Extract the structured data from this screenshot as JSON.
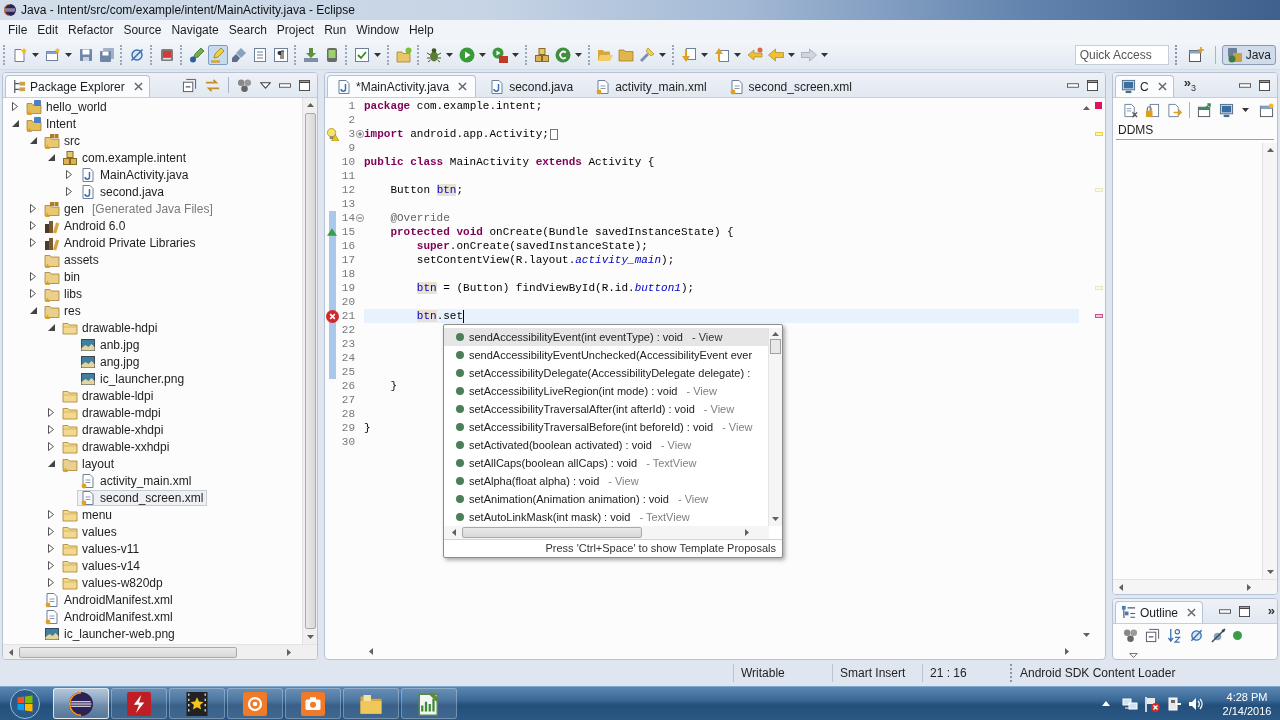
{
  "window": {
    "title": "Java - Intent/src/com/example/intent/MainActivity.java - Eclipse"
  },
  "menu": [
    "File",
    "Edit",
    "Refactor",
    "Source",
    "Navigate",
    "Search",
    "Project",
    "Run",
    "Window",
    "Help"
  ],
  "toolbar": {
    "groups": [
      [
        {
          "kind": "new",
          "dropdown": true,
          "pressed": false
        },
        {
          "kind": "new-window",
          "dropdown": true,
          "pressed": false
        },
        {
          "kind": "save",
          "pressed": false
        },
        {
          "kind": "save-all",
          "pressed": false
        }
      ],
      [
        {
          "kind": "skip-breakpoints",
          "pressed": false
        }
      ],
      [
        {
          "kind": "ddms",
          "pressed": false
        }
      ],
      [
        {
          "kind": "marker-pen",
          "pressed": false
        },
        {
          "kind": "highlighter",
          "pressed": true
        },
        {
          "kind": "brush",
          "pressed": false
        },
        {
          "kind": "block-select",
          "pressed": false
        },
        {
          "kind": "pilcrow",
          "pressed": false
        }
      ],
      [
        {
          "kind": "sdk-download",
          "pressed": false
        },
        {
          "kind": "phone",
          "pressed": false
        }
      ],
      [
        {
          "kind": "checkbox",
          "dropdown": true,
          "pressed": false
        }
      ],
      [
        {
          "kind": "new-project",
          "pressed": false
        }
      ],
      [
        {
          "kind": "bug",
          "dropdown": true,
          "pressed": false
        },
        {
          "kind": "play",
          "dropdown": true,
          "pressed": false
        },
        {
          "kind": "tool-run",
          "dropdown": true,
          "pressed": false
        }
      ],
      [
        {
          "kind": "package-new",
          "pressed": false
        },
        {
          "kind": "class-new",
          "dropdown": true,
          "pressed": false
        }
      ],
      [
        {
          "kind": "folder-open",
          "pressed": false
        },
        {
          "kind": "folder-task",
          "pressed": false
        },
        {
          "kind": "flashlight",
          "dropdown": true,
          "pressed": false
        }
      ],
      [
        {
          "kind": "annotation-next",
          "dropdown": true,
          "pressed": false
        },
        {
          "kind": "annotation-prev",
          "dropdown": true,
          "pressed": false
        },
        {
          "kind": "last-edit",
          "pressed": false
        },
        {
          "kind": "back",
          "dropdown": true,
          "pressed": false
        },
        {
          "kind": "forward",
          "dropdown": true,
          "pressed": false
        }
      ]
    ],
    "quick_access": {
      "placeholder": "Quick Access"
    },
    "perspectives": [
      {
        "kind": "open-perspective",
        "selected": false
      },
      {
        "kind": "java",
        "label": "Java",
        "selected": true
      }
    ]
  },
  "package_explorer": {
    "tab": {
      "label": "Package Explorer",
      "selected": true
    },
    "tree": [
      {
        "label": "hello_world",
        "kind": "project",
        "expanded": false,
        "selected": false
      },
      {
        "label": "Intent",
        "kind": "project",
        "expanded": true,
        "selected": false,
        "children": [
          {
            "label": "src",
            "kind": "source-folder",
            "expanded": true,
            "selected": false,
            "children": [
              {
                "label": "com.example.intent",
                "kind": "package",
                "expanded": true,
                "selected": false,
                "children": [
                  {
                    "label": "MainActivity.java",
                    "kind": "java-file",
                    "expanded": false,
                    "selected": false
                  },
                  {
                    "label": "second.java",
                    "kind": "java-file",
                    "expanded": false,
                    "selected": false
                  }
                ]
              }
            ]
          },
          {
            "label": "gen",
            "note": "[Generated Java Files]",
            "kind": "source-folder",
            "expanded": false,
            "selected": false
          },
          {
            "label": "Android 6.0",
            "kind": "library",
            "expanded": false,
            "selected": false
          },
          {
            "label": "Android Private Libraries",
            "kind": "library",
            "expanded": false,
            "selected": false
          },
          {
            "label": "assets",
            "kind": "resource-folder",
            "selected": false
          },
          {
            "label": "bin",
            "kind": "resource-folder",
            "expanded": false,
            "selected": false
          },
          {
            "label": "libs",
            "kind": "resource-folder",
            "expanded": false,
            "selected": false
          },
          {
            "label": "res",
            "kind": "resource-folder",
            "expanded": true,
            "selected": false,
            "children": [
              {
                "label": "drawable-hdpi",
                "kind": "folder",
                "expanded": true,
                "selected": false,
                "children": [
                  {
                    "label": "anb.jpg",
                    "kind": "image-file",
                    "selected": false
                  },
                  {
                    "label": "ang.jpg",
                    "kind": "image-file",
                    "selected": false
                  },
                  {
                    "label": "ic_launcher.png",
                    "kind": "image-file",
                    "selected": false
                  }
                ]
              },
              {
                "label": "drawable-ldpi",
                "kind": "folder",
                "selected": false
              },
              {
                "label": "drawable-mdpi",
                "kind": "folder",
                "expanded": false,
                "selected": false
              },
              {
                "label": "drawable-xhdpi",
                "kind": "folder",
                "expanded": false,
                "selected": false
              },
              {
                "label": "drawable-xxhdpi",
                "kind": "folder",
                "expanded": false,
                "selected": false
              },
              {
                "label": "layout",
                "kind": "resource-folder",
                "expanded": true,
                "selected": false,
                "children": [
                  {
                    "label": "activity_main.xml",
                    "kind": "xml-file",
                    "selected": false
                  },
                  {
                    "label": "second_screen.xml",
                    "kind": "xml-file",
                    "selected": true
                  }
                ]
              },
              {
                "label": "menu",
                "kind": "folder",
                "expanded": false,
                "selected": false
              },
              {
                "label": "values",
                "kind": "folder",
                "expanded": false,
                "selected": false
              },
              {
                "label": "values-v11",
                "kind": "folder",
                "expanded": false,
                "selected": false
              },
              {
                "label": "values-v14",
                "kind": "folder",
                "expanded": false,
                "selected": false
              },
              {
                "label": "values-w820dp",
                "kind": "folder",
                "expanded": false,
                "selected": false
              }
            ]
          },
          {
            "label": "AndroidManifest.xml",
            "kind": "xml-file",
            "selected": false
          },
          {
            "label": "AndroidManifest.xml",
            "kind": "xml-file",
            "selected": false
          },
          {
            "label": "ic_launcher-web.png",
            "kind": "image-file",
            "selected": false
          }
        ]
      }
    ]
  },
  "editor": {
    "tabs": [
      {
        "label": "*MainActivity.java",
        "kind": "java-file",
        "selected": true
      },
      {
        "label": "second.java",
        "kind": "java-file",
        "selected": false
      },
      {
        "label": "activity_main.xml",
        "kind": "xml-file",
        "selected": false
      },
      {
        "label": "second_screen.xml",
        "kind": "xml-file",
        "selected": false
      }
    ],
    "lines": [
      {
        "number": "1",
        "tokens": [
          {
            "text": "package",
            "kind": "keyword"
          },
          {
            "text": " com.example.intent;",
            "kind": "plain"
          }
        ]
      },
      {
        "number": "2"
      },
      {
        "number": "3",
        "gutter_mark": {
          "kind": "warning"
        },
        "fold": {
          "collapsed": true
        },
        "tokens": [
          {
            "text": "import",
            "kind": "keyword"
          },
          {
            "text": " android.app.Activity;",
            "kind": "plain"
          }
        ]
      },
      {
        "number": "9"
      },
      {
        "number": "10",
        "tokens": [
          {
            "text": "public",
            "kind": "keyword"
          },
          {
            "text": " class",
            "kind": "keyword"
          },
          {
            "text": " MainActivity ",
            "kind": "plain"
          },
          {
            "text": "extends",
            "kind": "keyword"
          },
          {
            "text": " Activity {",
            "kind": "plain"
          }
        ]
      },
      {
        "number": "11"
      },
      {
        "number": "12",
        "tokens": [
          {
            "text": "    Button ",
            "kind": "plain"
          },
          {
            "text": "btn",
            "kind": "occurrence"
          },
          {
            "text": ";",
            "kind": "plain"
          }
        ]
      },
      {
        "number": "13"
      },
      {
        "number": "14",
        "changed": true,
        "fold": {
          "collapsed": false
        },
        "tokens": [
          {
            "text": "    @Override",
            "kind": "annotation"
          }
        ]
      },
      {
        "number": "15",
        "changed": true,
        "gutter_mark": {
          "kind": "override"
        },
        "tokens": [
          {
            "text": "    protected",
            "kind": "keyword"
          },
          {
            "text": " void",
            "kind": "keyword"
          },
          {
            "text": " onCreate(Bundle savedInstanceState) {",
            "kind": "plain"
          }
        ]
      },
      {
        "number": "16",
        "changed": true,
        "tokens": [
          {
            "text": "        super",
            "kind": "keyword"
          },
          {
            "text": ".onCreate(savedInstanceState);",
            "kind": "plain"
          }
        ]
      },
      {
        "number": "17",
        "changed": true,
        "tokens": [
          {
            "text": "        setContentView(R.layout.",
            "kind": "plain"
          },
          {
            "text": "activity_main",
            "kind": "static"
          },
          {
            "text": ");",
            "kind": "plain"
          }
        ]
      },
      {
        "number": "18",
        "changed": true
      },
      {
        "number": "19",
        "changed": true,
        "tokens": [
          {
            "text": "        btn",
            "kind": "occurrence"
          },
          {
            "text": " = (Button) findViewById(R.id.",
            "kind": "plain"
          },
          {
            "text": "button1",
            "kind": "static"
          },
          {
            "text": ");",
            "kind": "plain"
          }
        ]
      },
      {
        "number": "20",
        "changed": true
      },
      {
        "number": "21",
        "changed": true,
        "current": true,
        "gutter_mark": {
          "kind": "error"
        },
        "tokens": [
          {
            "text": "        btn",
            "kind": "occurrence"
          },
          {
            "text": ".set",
            "kind": "plain"
          }
        ]
      },
      {
        "number": "22",
        "changed": true
      },
      {
        "number": "23",
        "changed": true
      },
      {
        "number": "24",
        "changed": true
      },
      {
        "number": "25",
        "changed": true
      },
      {
        "number": "26",
        "tokens": [
          {
            "text": "    }",
            "kind": "plain"
          }
        ]
      },
      {
        "number": "27"
      },
      {
        "number": "28"
      },
      {
        "number": "29",
        "tokens": [
          {
            "text": "}",
            "kind": "plain"
          }
        ]
      },
      {
        "number": "30"
      }
    ],
    "completion": {
      "proposals": [
        {
          "signature": "sendAccessibilityEvent(int eventType) : void",
          "qualifier": "- View",
          "selected": true
        },
        {
          "signature": "sendAccessibilityEventUnchecked(AccessibilityEvent ever",
          "selected": false
        },
        {
          "signature": "setAccessibilityDelegate(AccessibilityDelegate delegate) :",
          "selected": false
        },
        {
          "signature": "setAccessibilityLiveRegion(int mode) : void",
          "qualifier": "- View",
          "selected": false
        },
        {
          "signature": "setAccessibilityTraversalAfter(int afterId) : void",
          "qualifier": "- View",
          "selected": false
        },
        {
          "signature": "setAccessibilityTraversalBefore(int beforeId) : void",
          "qualifier": "- View",
          "selected": false
        },
        {
          "signature": "setActivated(boolean activated) : void",
          "qualifier": "- View",
          "selected": false
        },
        {
          "signature": "setAllCaps(boolean allCaps) : void",
          "qualifier": "- TextView",
          "selected": false
        },
        {
          "signature": "setAlpha(float alpha) : void",
          "qualifier": "- View",
          "selected": false
        },
        {
          "signature": "setAnimation(Animation animation) : void",
          "qualifier": "- View",
          "selected": false
        },
        {
          "signature": "setAutoLinkMask(int mask) : void",
          "qualifier": "- TextView",
          "selected": false
        }
      ],
      "hint": "Press 'Ctrl+Space' to show Template Proposals"
    }
  },
  "right_panel": {
    "tab": {
      "label": "C",
      "selected": true
    },
    "more_views": "»$_{3}$",
    "view_label": "DDMS"
  },
  "outline": {
    "tab": {
      "label": "Outline",
      "selected": true
    },
    "more_views": "»"
  },
  "status_bar": [
    "Writable",
    "Smart Insert",
    "21 : 16",
    "Android SDK Content Loader"
  ],
  "taskbar": {
    "apps": [
      {
        "kind": "eclipse",
        "selected": true
      },
      {
        "kind": "filezilla",
        "selected": false
      },
      {
        "kind": "movie",
        "selected": false
      },
      {
        "kind": "recorder",
        "selected": false
      },
      {
        "kind": "camera",
        "selected": false
      },
      {
        "kind": "explorer",
        "selected": false
      },
      {
        "kind": "notepad",
        "selected": false
      }
    ],
    "clock": {
      "time": "4:28 PM",
      "date": "2/14/2016"
    }
  }
}
